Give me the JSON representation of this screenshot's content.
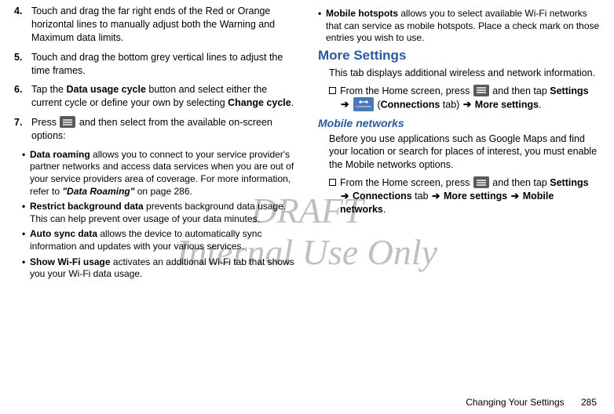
{
  "watermark": {
    "line1": "DRAFT",
    "line2": "Internal Use Only"
  },
  "left": {
    "items": [
      {
        "num": "4.",
        "pre": "Touch and drag the far right ends of the Red or Orange horizontal lines to manually adjust both the Warning and Maximum data limits."
      },
      {
        "num": "5.",
        "pre": "Touch and drag the bottom grey vertical lines to adjust the time frames."
      },
      {
        "num": "6.",
        "pre": "Tap the ",
        "bold1": "Data usage cycle",
        "mid": " button and select either the current cycle or define your own by selecting ",
        "bold2": "Change cycle",
        "post": "."
      },
      {
        "num": "7.",
        "pre": "Press ",
        "post": " and then select from the available on-screen options:"
      }
    ],
    "sub": [
      {
        "bold": "Data roaming",
        "text": " allows you to connect to your service provider's partner networks and access data services when you are out of your service providers area of coverage. For more information, refer to ",
        "ital": "\"Data Roaming\"",
        "tail": "  on page 286."
      },
      {
        "bold": "Restrict background data",
        "text": " prevents background data usage. This can help prevent over usage of your data minutes."
      },
      {
        "bold": "Auto sync data",
        "text": " allows the device to automatically sync information and updates with your various services."
      },
      {
        "bold": "Show Wi-Fi usage",
        "text": " activates an additional Wi-Fi tab that shows you your Wi-Fi data usage."
      }
    ]
  },
  "right": {
    "topBullet": {
      "bold": "Mobile hotspots",
      "text": " allows you to select available Wi-Fi networks that can service as mobile hotspots. Place a check mark on those entries you wish to use."
    },
    "h1": "More Settings",
    "p1": "This tab displays additional wireless and network information.",
    "sq1": {
      "pre": "From the Home screen, press ",
      "mid1": " and then tap ",
      "settings": "Settings",
      "connTab": "Connections",
      "tabWord": " tab) ",
      "more": "More settings",
      "post": "."
    },
    "h2": "Mobile networks",
    "p2": "Before you use applications such as Google Maps and find your location or search for places of interest, you must enable the Mobile networks options.",
    "sq2": {
      "pre": "From the Home screen, press ",
      "mid1": " and then tap ",
      "settings": "Settings",
      "conn": "Connections",
      "tabWord2": " tab ",
      "more2": "More settings",
      "mobile": "Mobile networks",
      "post": "."
    }
  },
  "arrow": "➔",
  "footer": {
    "section": "Changing Your Settings",
    "page": "285"
  },
  "connLabel": "Connections"
}
